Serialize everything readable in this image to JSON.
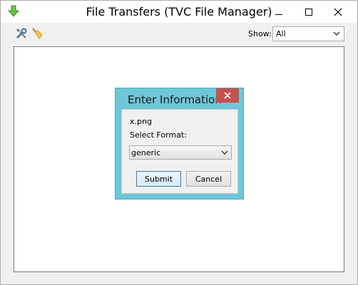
{
  "window": {
    "title": "File Transfers (TVC File Manager)",
    "app_icon": "green-down-arrow-icon"
  },
  "toolbar": {
    "tools_icon": "tools-icon",
    "clean_icon": "broom-icon",
    "show_label": "Show:",
    "show_value": "All"
  },
  "dialog": {
    "title": "Enter Information",
    "file_name": "x.png",
    "format_label": "Select Format:",
    "format_value": "generic",
    "submit_label": "Submit",
    "cancel_label": "Cancel",
    "colors": {
      "titlebar": "#6ec6d8",
      "close": "#c75050"
    }
  }
}
